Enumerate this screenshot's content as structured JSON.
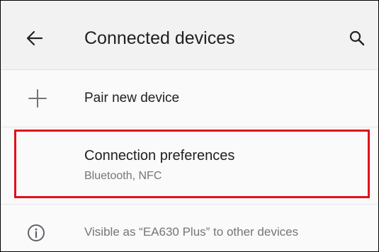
{
  "header": {
    "title": "Connected devices",
    "back_icon": "arrow-back-icon",
    "search_icon": "search-icon"
  },
  "list": {
    "pair_new_device": {
      "label": "Pair new device",
      "icon": "plus-icon"
    },
    "connection_preferences": {
      "label": "Connection preferences",
      "summary": "Bluetooth, NFC"
    },
    "visibility_info": {
      "text": "Visible as “EA630 Plus” to other devices",
      "icon": "info-icon"
    }
  },
  "colors": {
    "highlight": "#e0111b",
    "primary_text": "#212121",
    "secondary_text": "#757575",
    "appbar_bg": "#f2f2f2",
    "page_bg": "#fafafa"
  }
}
